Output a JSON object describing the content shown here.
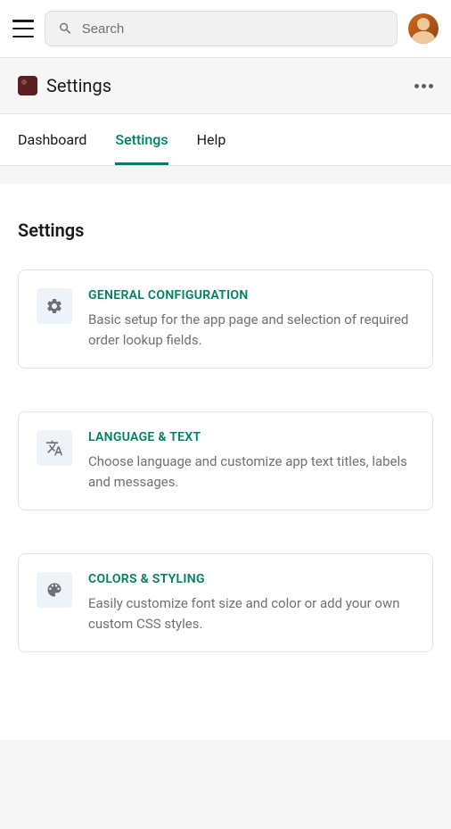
{
  "header": {
    "search_placeholder": "Search"
  },
  "app": {
    "title": "Settings"
  },
  "tabs": [
    {
      "label": "Dashboard",
      "active": false
    },
    {
      "label": "Settings",
      "active": true
    },
    {
      "label": "Help",
      "active": false
    }
  ],
  "page": {
    "title": "Settings"
  },
  "cards": [
    {
      "icon": "gear-icon",
      "title": "GENERAL CONFIGURATION",
      "description": "Basic setup for the app page and selection of required order lookup fields."
    },
    {
      "icon": "language-icon",
      "title": "LANGUAGE & TEXT",
      "description": "Choose language and customize app text titles, labels and messages."
    },
    {
      "icon": "palette-icon",
      "title": "COLORS & STYLING",
      "description": "Easily customize font size and color or add your own custom CSS styles."
    }
  ],
  "colors": {
    "accent": "#008060",
    "text_primary": "#1a1a1a",
    "text_secondary": "#6d7175",
    "border": "#e1e3e5",
    "bg_secondary": "#f6f6f7"
  }
}
